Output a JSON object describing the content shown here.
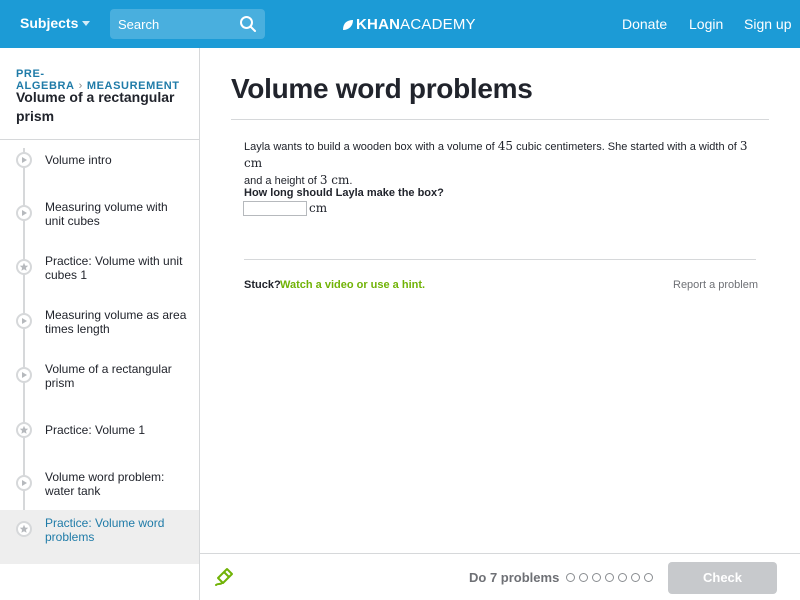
{
  "header": {
    "subjects_label": "Subjects",
    "search_placeholder": "Search",
    "logo_khan": "KHAN",
    "logo_academy": "ACADEMY",
    "nav": [
      "Donate",
      "Login",
      "Sign up"
    ]
  },
  "sidebar": {
    "breadcrumb": [
      "PRE-ALGEBRA",
      "MEASUREMENT"
    ],
    "title": "Volume of a rectangular prism",
    "items": [
      {
        "label": "Volume intro",
        "icon": "play-icon",
        "active": false
      },
      {
        "label": "Measuring volume with unit cubes",
        "icon": "play-icon",
        "active": false
      },
      {
        "label": "Practice: Volume with unit cubes 1",
        "icon": "star-icon",
        "active": false
      },
      {
        "label": "Measuring volume as area times length",
        "icon": "play-icon",
        "active": false
      },
      {
        "label": "Volume of a rectangular prism",
        "icon": "play-icon",
        "active": false
      },
      {
        "label": "Practice: Volume 1",
        "icon": "star-icon",
        "active": false
      },
      {
        "label": "Volume word problem: water tank",
        "icon": "play-icon",
        "active": false
      },
      {
        "label": "Practice: Volume word problems",
        "icon": "star-icon",
        "active": true
      }
    ]
  },
  "main": {
    "title": "Volume word problems",
    "question": {
      "p1": "Layla wants to build a wooden box with a volume of ",
      "v1": "45",
      "p2": " cubic centimeters. She started with a width of ",
      "v2": "3 cm",
      "p3": " and a height of ",
      "v3": "3 cm",
      "p4": "."
    },
    "prompt": "How long should Layla make the box?",
    "answer_value": "",
    "unit": "cm",
    "stuck_label": "Stuck?",
    "hint_link": "Watch a video or use a hint.",
    "report_link": "Report a problem"
  },
  "footer": {
    "do_label": "Do 7 problems",
    "progress_total": 7,
    "progress_done": 0,
    "check_label": "Check"
  },
  "colors": {
    "header_bg": "#1c9bd6",
    "link_teal": "#1f7ba8",
    "hint_green": "#71b307",
    "check_disabled": "#c7c9cc"
  }
}
